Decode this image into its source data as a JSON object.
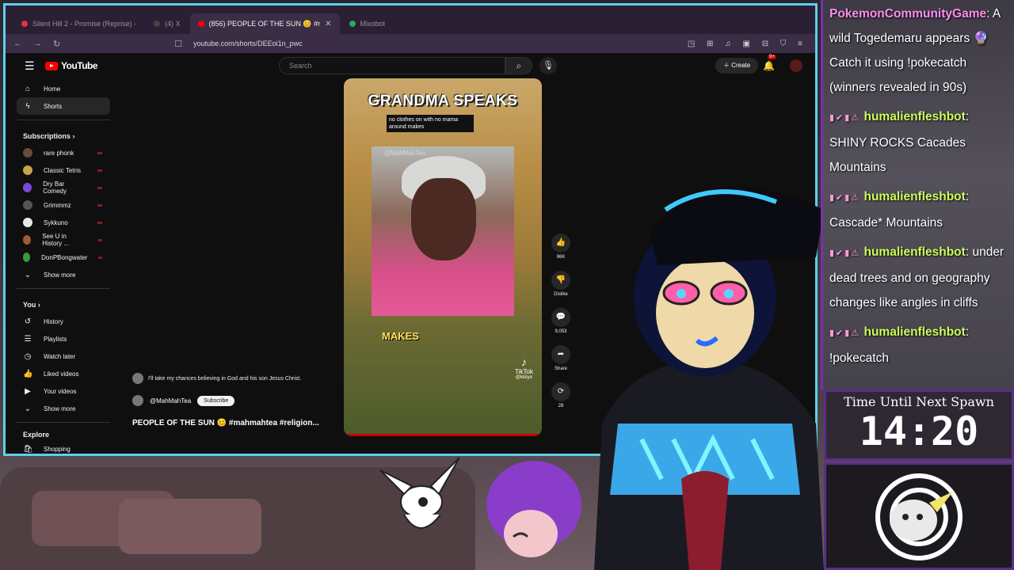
{
  "browser": {
    "tabs": [
      {
        "label": "Silent Hill 2 - Promise (Reprise) -",
        "color": "#e0334a",
        "active": false
      },
      {
        "label": "(4) X",
        "color": "#444444",
        "active": false
      },
      {
        "label": "(856) PEOPLE OF THE SUN 😊 #r",
        "color": "#ff0000",
        "active": true
      },
      {
        "label": "Mixobot",
        "color": "#22aa66",
        "active": false
      }
    ],
    "url": "youtube.com/shorts/DEEoi1n_pwc"
  },
  "youtube": {
    "logo_text": "YouTube",
    "search_placeholder": "Search",
    "create_label": "Create",
    "notif_count": "9+",
    "sidebar": {
      "main": [
        {
          "label": "Home",
          "icon": "home-icon"
        },
        {
          "label": "Shorts",
          "icon": "shorts-icon"
        }
      ],
      "subscriptions_heading": "Subscriptions",
      "subscriptions": [
        {
          "label": "rare phonk",
          "color": "#6b4a3a"
        },
        {
          "label": "Classic Tetris",
          "color": "#c9a54a"
        },
        {
          "label": "Dry Bar Comedy",
          "color": "#7b4ad8"
        },
        {
          "label": "Grimmmz",
          "color": "#555555"
        },
        {
          "label": "Sykkuno",
          "color": "#e8e8e8"
        },
        {
          "label": "See U in History ...",
          "color": "#a05a3a"
        },
        {
          "label": "DonPBongwater",
          "color": "#3a9a3a"
        }
      ],
      "show_more": "Show more",
      "you_heading": "You",
      "you_items": [
        {
          "label": "History",
          "icon": "history-icon"
        },
        {
          "label": "Playlists",
          "icon": "playlists-icon"
        },
        {
          "label": "Watch later",
          "icon": "watch-later-icon"
        },
        {
          "label": "Liked videos",
          "icon": "liked-videos-icon"
        },
        {
          "label": "Your videos",
          "icon": "your-videos-icon"
        }
      ],
      "show_more_2": "Show more",
      "explore_heading": "Explore",
      "explore_items": [
        {
          "label": "Shopping",
          "icon": "shopping-icon"
        }
      ]
    },
    "short": {
      "overlay_title": "GRANDMA SPEAKS",
      "caption": "no clothes on with no mama around makes",
      "inset_word": "MAKES",
      "watermark": "TikTok",
      "watermark_user": "@kkiiye",
      "inset_user": "@MahMahTea"
    },
    "actions": [
      {
        "icon": "like-icon",
        "label": "96K"
      },
      {
        "icon": "dislike-icon",
        "label": "Dislike"
      },
      {
        "icon": "comment-icon",
        "label": "9,053"
      },
      {
        "icon": "share-icon",
        "label": "Share"
      },
      {
        "icon": "remix-icon",
        "label": "28"
      }
    ],
    "top_comment": "I'll take my chances believing in God and his son Jesus Christ.",
    "channel": "@MahMahTea",
    "subscribe_label": "Subscribe",
    "video_title": "PEOPLE OF THE SUN 😊 #mahmahtea #religion..."
  },
  "chat": {
    "messages": [
      {
        "user": "PokemonCommunityGame",
        "text": "A wild Togedemaru appears 🔮 Catch it using !pokecatch (winners revealed in 90s)",
        "user_class": "user1"
      },
      {
        "user": "humalienfleshbot",
        "text": "SHINY ROCKS Cacades Mountains",
        "user_class": "user2"
      },
      {
        "user": "humalienfleshbot",
        "text": "Cascade* Mountains",
        "user_class": "user2"
      },
      {
        "user": "humalienfleshbot",
        "text": "under dead trees and on geography changes like angles in cliffs",
        "user_class": "user2"
      },
      {
        "user": "humalienfleshbot",
        "text": "!pokecatch",
        "user_class": "user2"
      }
    ]
  },
  "timer": {
    "label": "Time Until Next Spawn",
    "value": "14:20"
  }
}
